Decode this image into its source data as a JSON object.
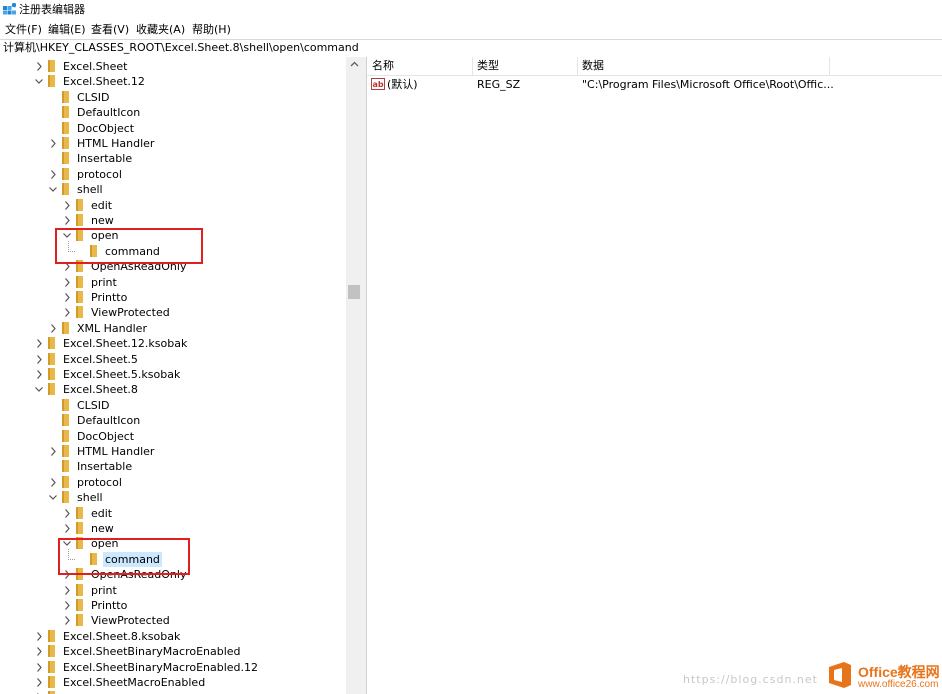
{
  "window": {
    "title": "注册表编辑器",
    "icon": "registry-editor-icon"
  },
  "menu": [
    "文件(F)",
    "编辑(E)",
    "查看(V)",
    "收藏夹(A)",
    "帮助(H)"
  ],
  "address": "计算机\\HKEY_CLASSES_ROOT\\Excel.Sheet.8\\shell\\open\\command",
  "tree": [
    {
      "label": "Excel.Sheet",
      "state": "collapsed",
      "level": 0
    },
    {
      "label": "Excel.Sheet.12",
      "state": "expanded",
      "level": 0
    },
    {
      "label": "CLSID",
      "state": "leaf",
      "level": 1
    },
    {
      "label": "DefaultIcon",
      "state": "leaf",
      "level": 1
    },
    {
      "label": "DocObject",
      "state": "leaf",
      "level": 1
    },
    {
      "label": "HTML Handler",
      "state": "collapsed",
      "level": 1
    },
    {
      "label": "Insertable",
      "state": "leaf",
      "level": 1
    },
    {
      "label": "protocol",
      "state": "collapsed",
      "level": 1
    },
    {
      "label": "shell",
      "state": "expanded",
      "level": 1
    },
    {
      "label": "edit",
      "state": "collapsed",
      "level": 2
    },
    {
      "label": "new",
      "state": "collapsed",
      "level": 2
    },
    {
      "label": "open",
      "state": "expanded",
      "level": 2
    },
    {
      "label": "command",
      "state": "leaf",
      "level": 3
    },
    {
      "label": "OpenAsReadOnly",
      "state": "collapsed",
      "level": 2
    },
    {
      "label": "print",
      "state": "collapsed",
      "level": 2
    },
    {
      "label": "Printto",
      "state": "collapsed",
      "level": 2
    },
    {
      "label": "ViewProtected",
      "state": "collapsed",
      "level": 2
    },
    {
      "label": "XML Handler",
      "state": "collapsed",
      "level": 1
    },
    {
      "label": "Excel.Sheet.12.ksobak",
      "state": "collapsed",
      "level": 0
    },
    {
      "label": "Excel.Sheet.5",
      "state": "collapsed",
      "level": 0
    },
    {
      "label": "Excel.Sheet.5.ksobak",
      "state": "collapsed",
      "level": 0
    },
    {
      "label": "Excel.Sheet.8",
      "state": "expanded",
      "level": 0
    },
    {
      "label": "CLSID",
      "state": "leaf",
      "level": 1
    },
    {
      "label": "DefaultIcon",
      "state": "leaf",
      "level": 1
    },
    {
      "label": "DocObject",
      "state": "leaf",
      "level": 1
    },
    {
      "label": "HTML Handler",
      "state": "collapsed",
      "level": 1
    },
    {
      "label": "Insertable",
      "state": "leaf",
      "level": 1
    },
    {
      "label": "protocol",
      "state": "collapsed",
      "level": 1
    },
    {
      "label": "shell",
      "state": "expanded",
      "level": 1
    },
    {
      "label": "edit",
      "state": "collapsed",
      "level": 2
    },
    {
      "label": "new",
      "state": "collapsed",
      "level": 2
    },
    {
      "label": "open",
      "state": "expanded",
      "level": 2
    },
    {
      "label": "command",
      "state": "leaf",
      "level": 3,
      "selected": true
    },
    {
      "label": "OpenAsReadOnly",
      "state": "collapsed",
      "level": 2
    },
    {
      "label": "print",
      "state": "collapsed",
      "level": 2
    },
    {
      "label": "Printto",
      "state": "collapsed",
      "level": 2
    },
    {
      "label": "ViewProtected",
      "state": "collapsed",
      "level": 2
    },
    {
      "label": "Excel.Sheet.8.ksobak",
      "state": "collapsed",
      "level": 0
    },
    {
      "label": "Excel.SheetBinaryMacroEnabled",
      "state": "collapsed",
      "level": 0
    },
    {
      "label": "Excel.SheetBinaryMacroEnabled.12",
      "state": "collapsed",
      "level": 0
    },
    {
      "label": "Excel.SheetMacroEnabled",
      "state": "collapsed",
      "level": 0
    },
    {
      "label": "",
      "state": "collapsed",
      "level": 0
    }
  ],
  "list": {
    "columns": [
      "名称",
      "类型",
      "数据"
    ],
    "rows": [
      {
        "name": "(默认)",
        "type": "REG_SZ",
        "data": "\"C:\\Program Files\\Microsoft Office\\Root\\Offic..."
      }
    ]
  },
  "watermark": {
    "text": "https://blog.csdn.net",
    "brand": "Office教程网",
    "url": "www.office26.com"
  },
  "colors": {
    "highlight": "#e02020",
    "selection": "#cce8ff",
    "folder": "#e8b84a",
    "brand": "#e8741a"
  }
}
